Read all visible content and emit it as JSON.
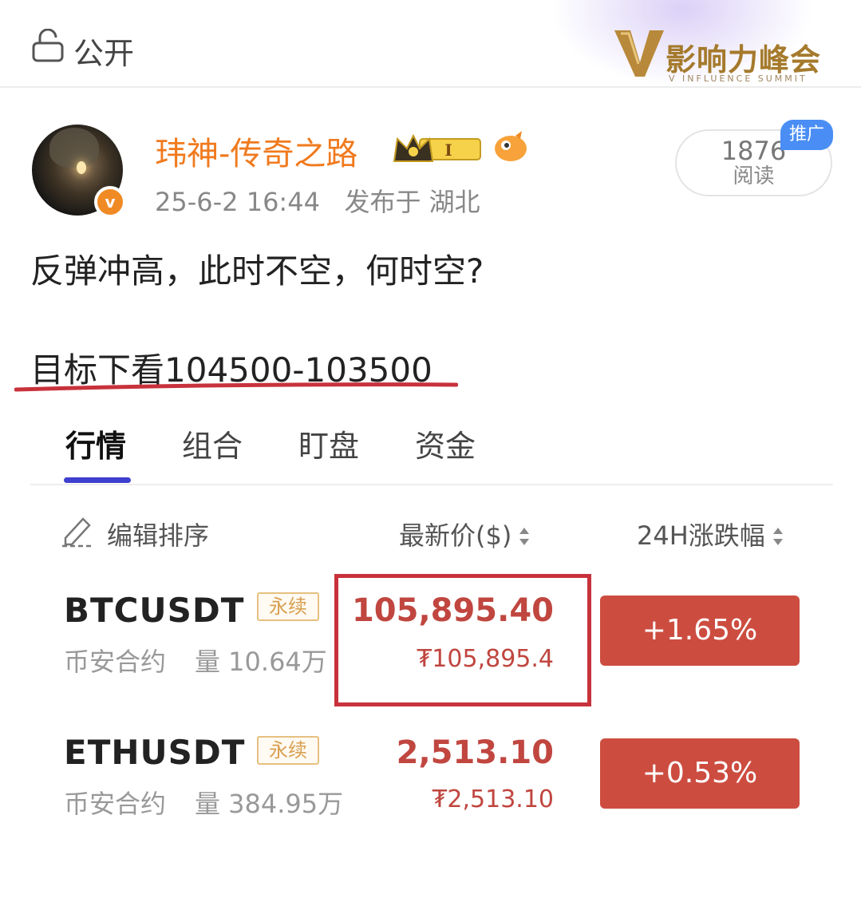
{
  "header": {
    "visibility_label": "公开",
    "brand_name": "影响力峰会",
    "brand_subtitle": "V INFLUENCE SUMMIT"
  },
  "post": {
    "author": "玮神-传奇之路",
    "level_badge": "I",
    "timestamp": "25-6-2 16:44",
    "location": "发布于 湖北",
    "read_count": "1876",
    "read_label": "阅读",
    "promo_badge": "推广",
    "line1": "反弹冲高，此时不空，何时空?",
    "line2": "目标下看104500-103500"
  },
  "tabs": [
    "行情",
    "组合",
    "盯盘",
    "资金"
  ],
  "active_tab": 0,
  "table": {
    "edit_label": "编辑排序",
    "col_price": "最新价($)",
    "col_change": "24H涨跌幅",
    "rows": [
      {
        "symbol": "BTCUSDT",
        "tag": "永续",
        "exchange": "币安合约",
        "volume": "量 10.64万",
        "price": "105,895.40",
        "price_cny": "₮105,895.4",
        "change": "+1.65%"
      },
      {
        "symbol": "ETHUSDT",
        "tag": "永续",
        "exchange": "币安合约",
        "volume": "量 384.95万",
        "price": "2,513.10",
        "price_cny": "₮2,513.10",
        "change": "+0.53%"
      }
    ]
  },
  "colors": {
    "username": "#f07a1e",
    "price_red": "#c0463f",
    "change_bg": "#cc4d40",
    "tab_indicator": "#3f3fd0",
    "highlight_box": "#c8323c",
    "promo": "#4a8ef5"
  },
  "icons": [
    "lock-icon",
    "v-logo-icon",
    "crown-badge-icon",
    "fish-badge-icon",
    "verified-v-icon",
    "edit-icon",
    "sort-icon"
  ]
}
